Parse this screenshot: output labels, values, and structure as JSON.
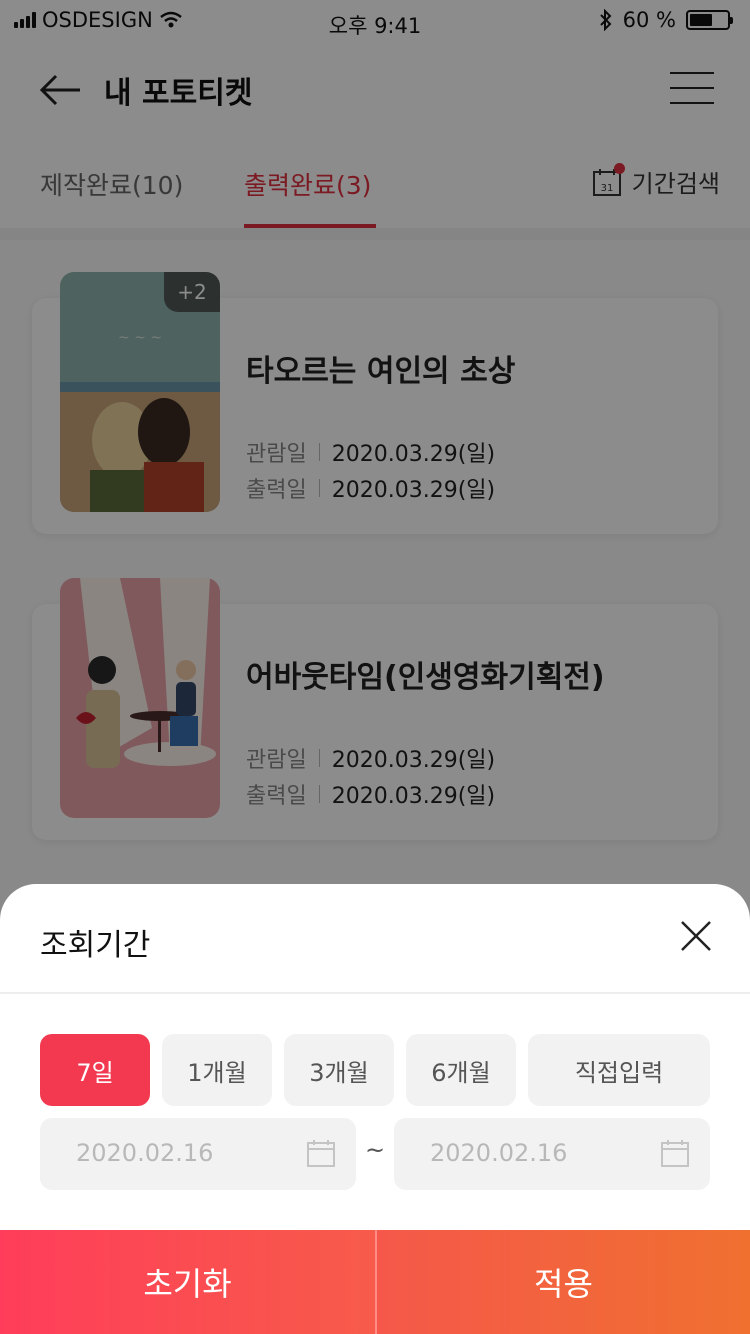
{
  "status": {
    "carrier": "OSDESIGN",
    "time": "오후 9:41",
    "battery": "60 %",
    "battery_level": 0.6
  },
  "header": {
    "title": "내 포토티켓",
    "back_icon": "arrow-left-icon",
    "menu_icon": "hamburger-menu-icon"
  },
  "tabs": [
    {
      "label": "제작완료(10)",
      "active": false
    },
    {
      "label": "출력완료(3)",
      "active": true
    }
  ],
  "period_search": {
    "label": "기간검색",
    "calendar_day": "31"
  },
  "tickets": [
    {
      "title": "타오르는 여인의 초상",
      "badge": "+2",
      "watch_label": "관람일",
      "watch_date": "2020.03.29(일)",
      "print_label": "출력일",
      "print_date": "2020.03.29(일)"
    },
    {
      "title": "어바웃타임(인생영화기획전)",
      "badge": "",
      "watch_label": "관람일",
      "watch_date": "2020.03.29(일)",
      "print_label": "출력일",
      "print_date": "2020.03.29(일)"
    }
  ],
  "sheet": {
    "title": "조회기간",
    "chips": [
      {
        "label": "7일",
        "active": true
      },
      {
        "label": "1개월",
        "active": false
      },
      {
        "label": "3개월",
        "active": false
      },
      {
        "label": "6개월",
        "active": false
      },
      {
        "label": "직접입력",
        "active": false
      }
    ],
    "start_date": "2020.02.16",
    "separator": "~",
    "end_date": "2020.02.16",
    "reset_label": "초기화",
    "apply_label": "적용"
  },
  "colors": {
    "accent": "#e0303f",
    "chip_active": "#f2394f",
    "btn_reset": "#ff3d5a",
    "btn_apply": "#f07030"
  }
}
